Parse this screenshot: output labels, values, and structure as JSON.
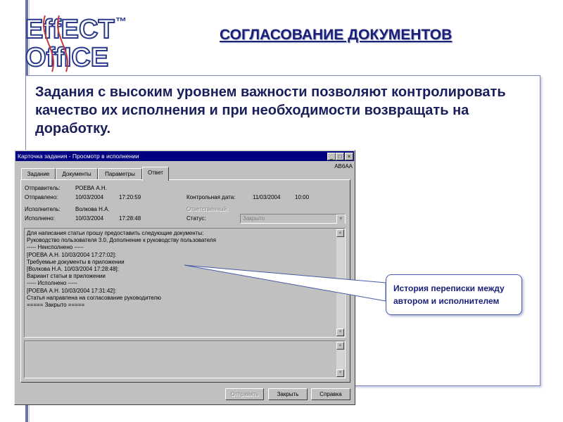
{
  "logo": {
    "line1": "EffECT",
    "line2": "OffICE",
    "tm": "™"
  },
  "slide": {
    "title": "СОГЛАСОВАНИЕ ДОКУМЕНТОВ",
    "main_text": "Задания с высоким уровнем важности позволяют контролировать качество их исполнения и при необходимости возвращать на доработку."
  },
  "window": {
    "title": "Карточка задания - Просмотр в исполнении",
    "code": "АВ6АА",
    "title_buttons": [
      "_",
      "□",
      "×"
    ],
    "tabs": [
      {
        "label": "Задание",
        "active": false
      },
      {
        "label": "Документы",
        "active": false
      },
      {
        "label": "Параметры",
        "active": false
      },
      {
        "label": "Ответ",
        "active": true
      }
    ],
    "fields": {
      "sender_label": "Отправитель:",
      "sender_value": "РОЕВА А.Н.",
      "sent_label": "Отправлено:",
      "sent_date": "10/03/2004",
      "sent_time": "17:20:59",
      "control_label": "Контрольная дата:",
      "control_date": "11/03/2004",
      "control_time": "10:00",
      "executor_label": "Исполнитель:",
      "executor_value": "Волкова Н.А.",
      "responsible_label": "Ответственный:",
      "executed_label": "Исполнено:",
      "executed_date": "10/03/2004",
      "executed_time": "17:28:48",
      "status_label": "Статус:",
      "status_value": "Закрыто"
    },
    "history_lines": [
      "Для написания статьи прошу предоставить следующие документы:",
      "Руководство пользователя 3.0, Дополнение к руководству пользователя",
      "----- Неисполнено -----",
      "[РОЕВА А.Н. 10/03/2004 17:27:02]:",
      "Требуемые документы в приложении",
      "[Волкова Н.А. 10/03/2004 17:28:48]:",
      "Вариант статьи в приложении",
      "----- Исполнено -----",
      "[РОЕВА А.Н. 10/03/2004 17:31:42]:",
      "Статья направлена на согласование руководителю",
      "===== Закрыто ====="
    ],
    "reply_text": "",
    "buttons": {
      "send": "Отправить",
      "close": "Закрыть",
      "help": "Справка"
    }
  },
  "callout": {
    "text": "История переписки между автором и исполнителем"
  },
  "colors": {
    "accent": "#1a1f78",
    "titlebar": "#000080",
    "window_bg": "#c0c0c0"
  }
}
